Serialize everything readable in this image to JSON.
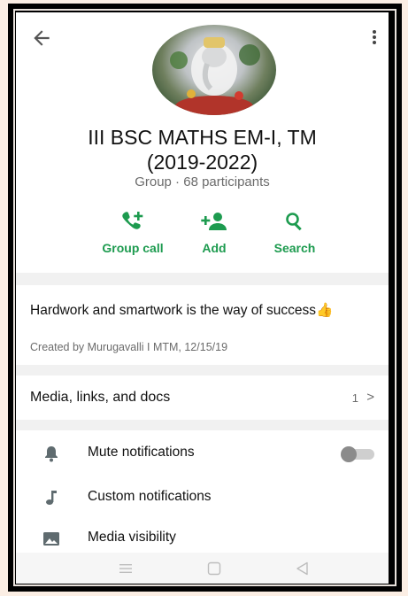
{
  "group": {
    "title": "III BSC MATHS EM-I, TM\n(2019-2022)",
    "subtitle": "Group · 68 participants"
  },
  "actions": {
    "group_call": "Group call",
    "add": "Add",
    "search": "Search"
  },
  "description": {
    "text": "Hardwork and smartwork is the way of success👍",
    "meta": "Created by Murugavalli I MTM, 12/15/19"
  },
  "media": {
    "label": "Media, links, and docs",
    "count": "1",
    "chevron": ">"
  },
  "settings": {
    "mute": "Mute notifications",
    "mute_enabled": false,
    "custom": "Custom notifications",
    "visibility": "Media visibility"
  },
  "colors": {
    "accent": "#1d9b4f",
    "icon_gray": "#5f6b6f"
  }
}
